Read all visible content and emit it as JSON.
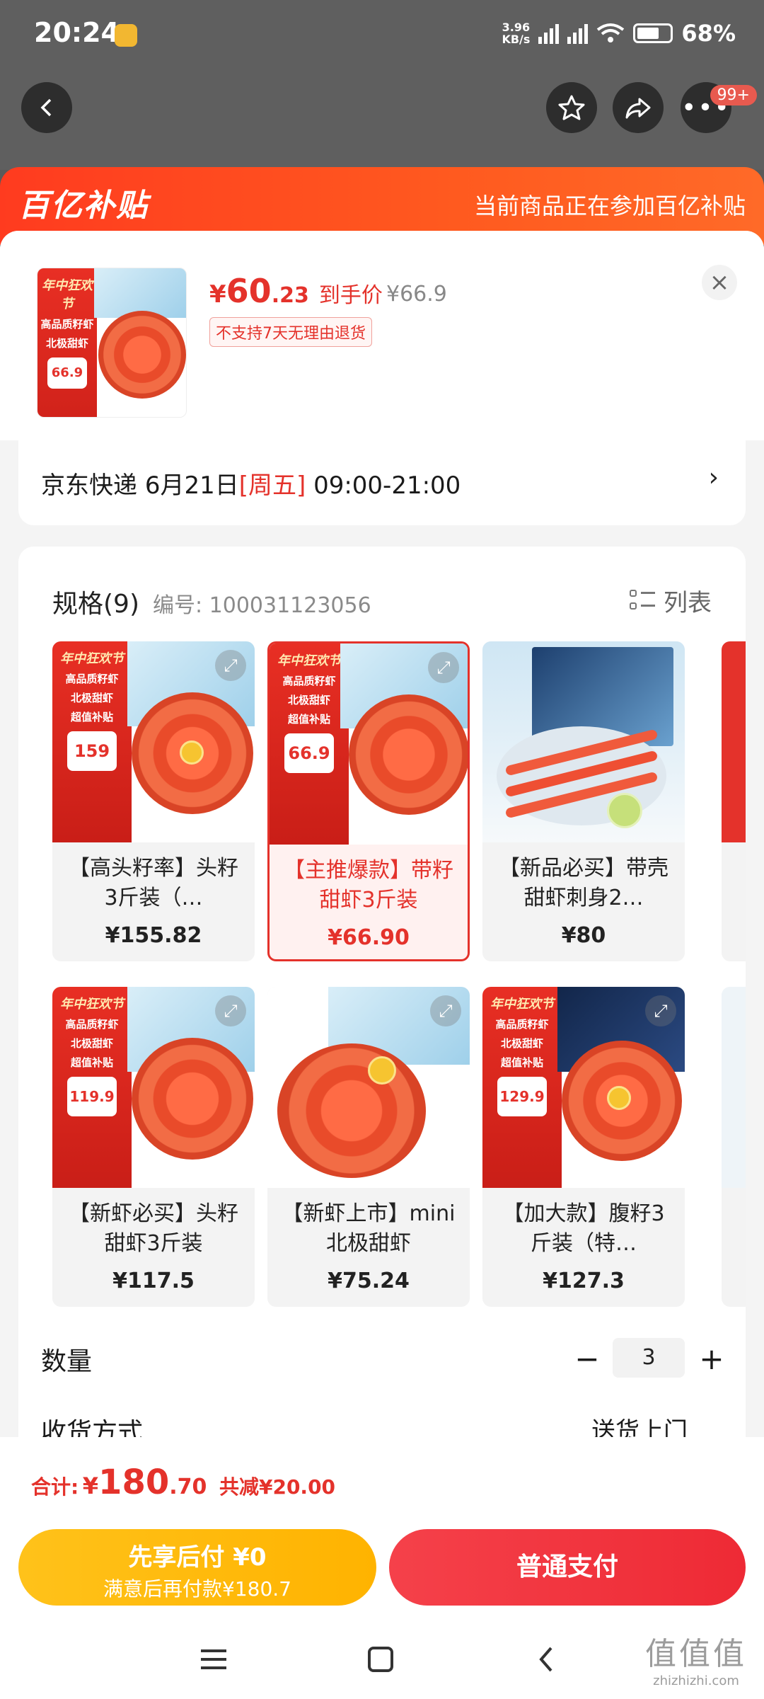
{
  "status_bar": {
    "time": "20:24",
    "net_speed_value": "3.96",
    "net_speed_unit": "KB/s",
    "battery": "68%",
    "more_badge": "99+"
  },
  "subsidy_banner": {
    "logo": "百亿补贴",
    "message": "当前商品正在参加百亿补贴"
  },
  "product": {
    "price_yen": "¥",
    "price_int": "60",
    "price_dec": ".23",
    "price_tag": "到手价",
    "original_price": "¥66.9",
    "no_return_tag": "不支持7天无理由退货"
  },
  "shipping": {
    "carrier": "京东快递",
    "date": "6月21日",
    "weekday": "[周五]",
    "window": "09:00-21:00",
    "arrow": "›"
  },
  "spec": {
    "title": "规格(9)",
    "code": "编号: 100031123056",
    "list_label": "列表",
    "items": [
      {
        "name": "【高头籽率】头籽3斤装（…",
        "price": "¥155.82",
        "promo_price": "159",
        "selected": false
      },
      {
        "name": "【主推爆款】带籽甜虾3斤装",
        "price": "¥66.90",
        "promo_price": "66.9",
        "selected": true
      },
      {
        "name": "【新品必买】带壳甜虾刺身2…",
        "price": "¥80",
        "selected": false
      },
      {
        "name": "【新虾必买】头籽甜虾3斤装",
        "price": "¥117.5",
        "promo_price": "119.9",
        "selected": false
      },
      {
        "name": "【新虾上市】mini北极甜虾",
        "price": "¥75.24",
        "selected": false
      },
      {
        "name": "【加大款】腹籽3斤装（特…",
        "price": "¥127.3",
        "promo_price": "129.9",
        "selected": false
      }
    ],
    "promo_header": "年中狂欢节",
    "promo_lines": [
      "高品质籽虾",
      "北极甜虾",
      "超值补贴"
    ]
  },
  "quantity": {
    "label": "数量",
    "value": "3",
    "minus": "−",
    "plus": "+"
  },
  "delivery": {
    "label": "收货方式",
    "value": "送货上门"
  },
  "summary": {
    "label": "合计:",
    "yen": "¥",
    "big": "180",
    "dec": ".70",
    "saved": "共减¥20.00"
  },
  "buttons": {
    "pay_later_line1": "先享后付 ¥0",
    "pay_later_line2": "满意后再付款¥180.7",
    "pay_now": "普通支付"
  },
  "watermark": {
    "glyphs": "值值值",
    "site": "zhizhizhi.com"
  },
  "colors": {
    "accent_red": "#e4322b",
    "subsidy_orange": "#ff4a1f",
    "pay_later_yellow": "#ffbb14"
  }
}
